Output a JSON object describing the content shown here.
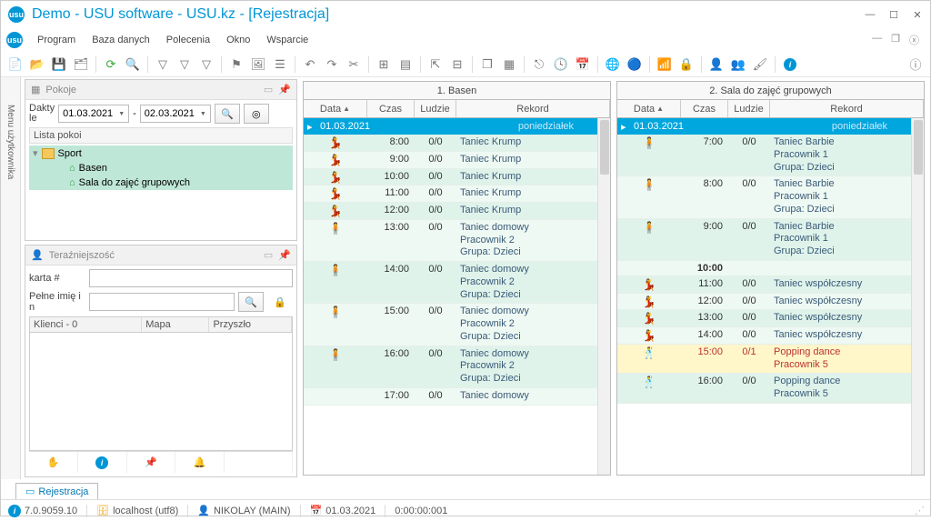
{
  "title": "Demo - USU software - USU.kz - [Rejestracja]",
  "menu": {
    "items": [
      "Program",
      "Baza danych",
      "Polecenia",
      "Okno",
      "Wsparcie"
    ]
  },
  "rooms_panel": {
    "title": "Pokoje",
    "date_label": "Dakty\nle",
    "date_from": "01.03.2021",
    "date_sep": "-",
    "date_to": "02.03.2021",
    "list_header": "Lista pokoi",
    "tree": {
      "root": "Sport",
      "children": [
        "Basen",
        "Sala do zajęć grupowych"
      ]
    }
  },
  "now_panel": {
    "title": "Teraźniejszość",
    "card_label": "karta #",
    "name_label": "Pełne imię i n",
    "grid": {
      "col1": "Klienci - 0",
      "col2": "Mapa",
      "col3": "Przyszło"
    }
  },
  "schedule1": {
    "title": "1. Basen",
    "cols": {
      "data": "Data",
      "czas": "Czas",
      "ludzie": "Ludzie",
      "rekord": "Rekord"
    },
    "day": {
      "date": "01.03.2021",
      "label": "poniedziałek"
    },
    "rows": [
      {
        "icon": "💃",
        "cls": "green",
        "czas": "8:00",
        "ludzie": "0/0",
        "lines": [
          "Taniec Krump"
        ]
      },
      {
        "icon": "💃",
        "cls": "lgreen",
        "czas": "9:00",
        "ludzie": "0/0",
        "lines": [
          "Taniec Krump"
        ]
      },
      {
        "icon": "💃",
        "cls": "green",
        "czas": "10:00",
        "ludzie": "0/0",
        "lines": [
          "Taniec Krump"
        ]
      },
      {
        "icon": "💃",
        "cls": "lgreen",
        "czas": "11:00",
        "ludzie": "0/0",
        "lines": [
          "Taniec Krump"
        ]
      },
      {
        "icon": "💃",
        "cls": "green",
        "czas": "12:00",
        "ludzie": "0/0",
        "lines": [
          "Taniec Krump"
        ]
      },
      {
        "icon": "🧍",
        "cls": "lgreen",
        "czas": "13:00",
        "ludzie": "0/0",
        "lines": [
          "Taniec domowy",
          "Pracownik 2",
          "Grupa: Dzieci"
        ]
      },
      {
        "icon": "🧍",
        "cls": "green",
        "czas": "14:00",
        "ludzie": "0/0",
        "lines": [
          "Taniec domowy",
          "Pracownik 2",
          "Grupa: Dzieci"
        ]
      },
      {
        "icon": "🧍",
        "cls": "lgreen",
        "czas": "15:00",
        "ludzie": "0/0",
        "lines": [
          "Taniec domowy",
          "Pracownik 2",
          "Grupa: Dzieci"
        ]
      },
      {
        "icon": "🧍",
        "cls": "green",
        "czas": "16:00",
        "ludzie": "0/0",
        "lines": [
          "Taniec domowy",
          "Pracownik 2",
          "Grupa: Dzieci"
        ]
      },
      {
        "icon": "",
        "cls": "lgreen",
        "czas": "17:00",
        "ludzie": "0/0",
        "lines": [
          "Taniec domowy"
        ]
      }
    ]
  },
  "schedule2": {
    "title": "2. Sala do zajęć grupowych",
    "cols": {
      "data": "Data",
      "czas": "Czas",
      "ludzie": "Ludzie",
      "rekord": "Rekord"
    },
    "day": {
      "date": "01.03.2021",
      "label": "poniedziałek"
    },
    "rows": [
      {
        "icon": "🧍",
        "cls": "green",
        "czas": "7:00",
        "ludzie": "0/0",
        "lines": [
          "Taniec Barbie",
          "Pracownik 1",
          "Grupa: Dzieci"
        ]
      },
      {
        "icon": "🧍",
        "cls": "lgreen",
        "czas": "8:00",
        "ludzie": "0/0",
        "lines": [
          "Taniec Barbie",
          "Pracownik 1",
          "Grupa: Dzieci"
        ]
      },
      {
        "icon": "🧍",
        "cls": "green",
        "czas": "9:00",
        "ludzie": "0/0",
        "lines": [
          "Taniec Barbie",
          "Pracownik 1",
          "Grupa: Dzieci"
        ]
      },
      {
        "icon": "",
        "cls": "lgreen",
        "czas": "10:00",
        "ludzie": "",
        "lines": [
          ""
        ],
        "bold": true
      },
      {
        "icon": "💃",
        "cls": "green",
        "czas": "11:00",
        "ludzie": "0/0",
        "lines": [
          "Taniec współczesny"
        ]
      },
      {
        "icon": "💃",
        "cls": "lgreen",
        "czas": "12:00",
        "ludzie": "0/0",
        "lines": [
          "Taniec współczesny"
        ]
      },
      {
        "icon": "💃",
        "cls": "green",
        "czas": "13:00",
        "ludzie": "0/0",
        "lines": [
          "Taniec współczesny"
        ]
      },
      {
        "icon": "💃",
        "cls": "lgreen",
        "czas": "14:00",
        "ludzie": "0/0",
        "lines": [
          "Taniec współczesny"
        ]
      },
      {
        "icon": "🕺",
        "cls": "yellow",
        "czas": "15:00",
        "ludzie": "0/1",
        "lines": [
          "Popping dance",
          "Pracownik 5"
        ]
      },
      {
        "icon": "🕺",
        "cls": "green",
        "czas": "16:00",
        "ludzie": "0/0",
        "lines": [
          "Popping dance",
          "Pracownik 5"
        ]
      }
    ]
  },
  "tab": "Rejestracja",
  "status": {
    "version": "7.0.9059.10",
    "host": "localhost (utf8)",
    "user": "NIKOLAY (MAIN)",
    "date": "01.03.2021",
    "timer": "0:00:00:001"
  }
}
